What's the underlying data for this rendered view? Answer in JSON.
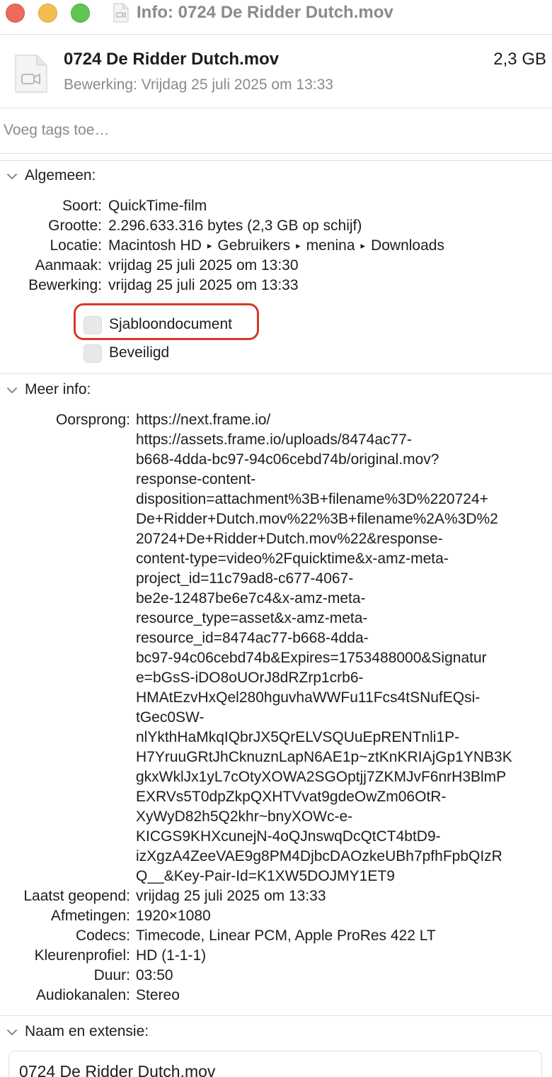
{
  "window": {
    "title": "Info: 0724 De Ridder Dutch.mov"
  },
  "header": {
    "file_name": "0724 De Ridder Dutch.mov",
    "file_size": "2,3 GB",
    "modified": "Bewerking: Vrijdag 25 juli 2025 om 13:33",
    "file_icon": "video-document-icon"
  },
  "tags": {
    "placeholder": "Voeg tags toe…"
  },
  "general": {
    "title": "Algemeen:",
    "kind_label": "Soort:",
    "kind_value": "QuickTime-film",
    "size_label": "Grootte:",
    "size_value": "2.296.633.316 bytes (2,3 GB op schijf)",
    "location_label": "Locatie:",
    "location_path": [
      "Macintosh HD",
      "Gebruikers",
      "menina",
      "Downloads"
    ],
    "created_label": "Aanmaak:",
    "created_value": "vrijdag 25 juli 2025 om 13:30",
    "modified_label": "Bewerking:",
    "modified_value": "vrijdag 25 juli 2025 om 13:33",
    "stationery_label": "Sjabloondocument",
    "stationery_checked": false,
    "locked_label": "Beveiligd",
    "locked_checked": false
  },
  "more_info": {
    "title": "Meer info:",
    "origin_label": "Oorsprong:",
    "origin_lines": [
      "https://next.frame.io/",
      "https://assets.frame.io/uploads/8474ac77-",
      "b668-4dda-bc97-94c06cebd74b/original.mov?",
      "response-content-",
      "disposition=attachment%3B+filename%3D%220724+",
      "De+Ridder+Dutch.mov%22%3B+filename%2A%3D%2",
      "20724+De+Ridder+Dutch.mov%22&response-",
      "content-type=video%2Fquicktime&x-amz-meta-",
      "project_id=11c79ad8-c677-4067-",
      "be2e-12487be6e7c4&x-amz-meta-",
      "resource_type=asset&x-amz-meta-",
      "resource_id=8474ac77-b668-4dda-",
      "bc97-94c06cebd74b&Expires=1753488000&Signatur",
      "e=bGsS-iDO8oUOrJ8dRZrp1crb6-",
      "HMAtEzvHxQel280hguvhaWWFu11Fcs4tSNufEQsi-",
      "tGec0SW-",
      "nlYkthHaMkqIQbrJX5QrELVSQUuEpRENTnli1P-",
      "H7YruuGRtJhCknuznLapN6AE1p~ztKnKRIAjGp1YNB3K",
      "gkxWklJx1yL7cOtyXOWA2SGOptjj7ZKMJvF6nrH3BlmP",
      "EXRVs5T0dpZkpQXHTVvat9gdeOwZm06OtR-",
      "XyWyD82h5Q2khr~bnyXOWc-e-",
      "KICGS9KHXcunejN-4oQJnswqDcQtCT4btD9-",
      "izXgzA4ZeeVAE9g8PM4DjbcDAOzkeUBh7pfhFpbQIzR",
      "Q__&Key-Pair-Id=K1XW5DOJMY1ET9"
    ],
    "last_opened_label": "Laatst geopend:",
    "last_opened_value": "vrijdag 25 juli 2025 om 13:33",
    "dimensions_label": "Afmetingen:",
    "dimensions_value": "1920×1080",
    "codecs_label": "Codecs:",
    "codecs_value": "Timecode, Linear PCM, Apple ProRes 422 LT",
    "color_profile_label": "Kleurenprofiel:",
    "color_profile_value": "HD (1-1-1)",
    "duration_label": "Duur:",
    "duration_value": "03:50",
    "audio_channels_label": "Audiokanalen:",
    "audio_channels_value": "Stereo"
  },
  "name_extension": {
    "title": "Naam en extensie:",
    "name_value": "0724 De Ridder Dutch.mov"
  },
  "colors": {
    "close": "#ec6a5e",
    "minimize": "#f4be4f",
    "maximize": "#61c454",
    "highlight": "#d63a27",
    "secondary_text": "#8a8a8e"
  }
}
